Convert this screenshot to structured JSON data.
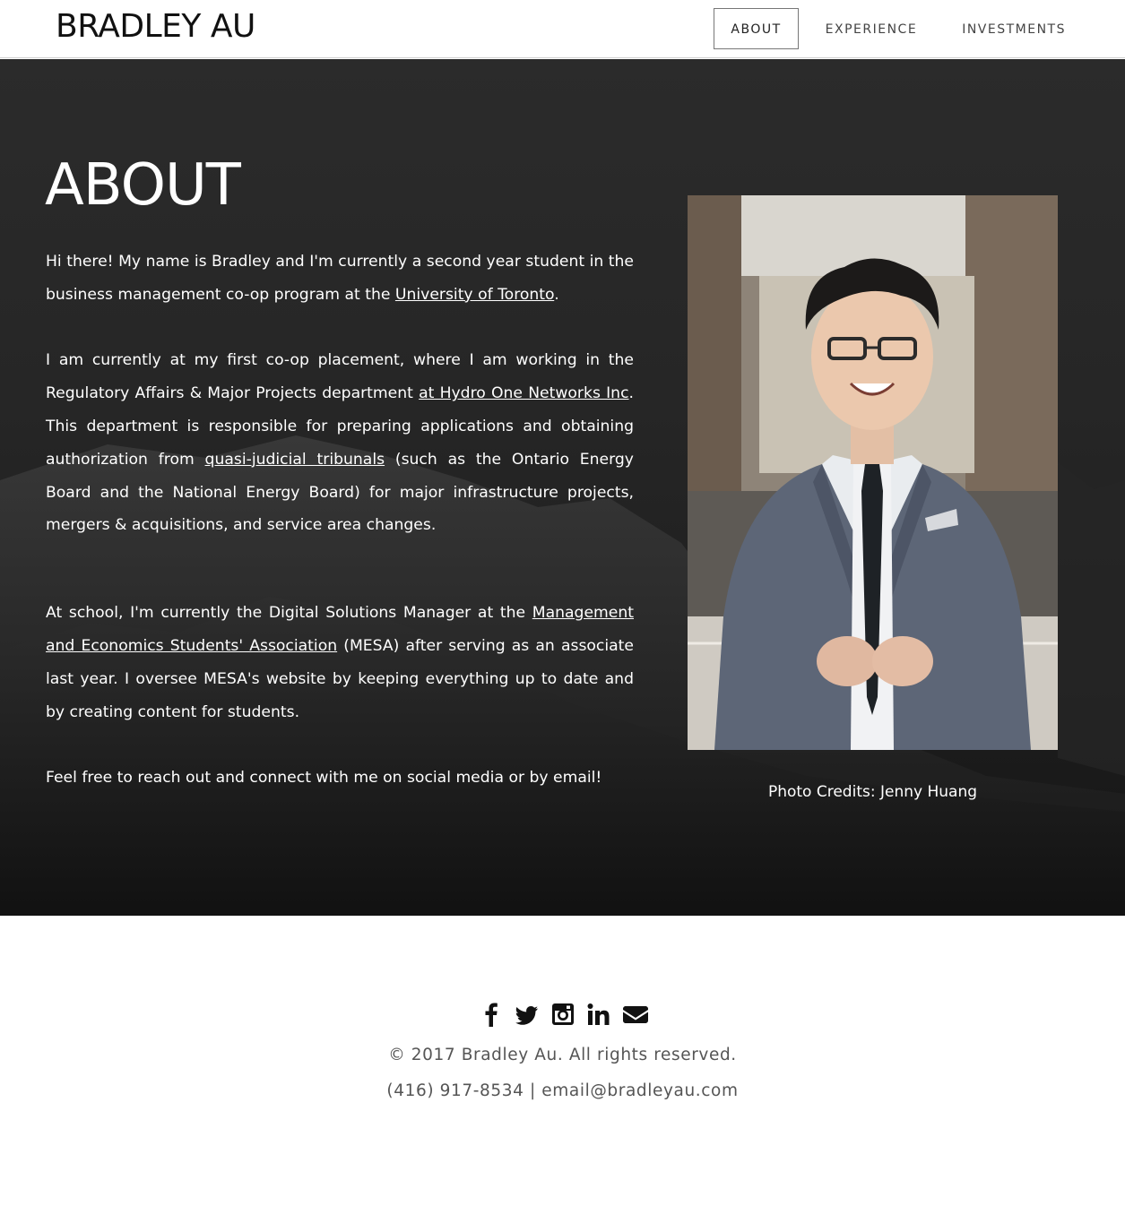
{
  "header": {
    "logo": "BRADLEY AU",
    "nav": [
      {
        "label": "ABOUT",
        "active": true
      },
      {
        "label": "EXPERIENCE",
        "active": false
      },
      {
        "label": "INVESTMENTS",
        "active": false
      }
    ]
  },
  "about": {
    "title": "ABOUT",
    "p1": {
      "text_before": "Hi there! My name is Bradley and I'm currently a second year student in the business management co-op program at the ",
      "link": "University of Toronto",
      "text_after": "."
    },
    "p2": {
      "text_before": "I am currently at my first co-op placement, where I am working in the Regulatory Affairs & Major Projects department ",
      "link1": "at Hydro One Networks Inc",
      "text_middle": ". This department is responsible for preparing applications and obtaining authorization from ",
      "link2": "quasi-judicial tribunals",
      "text_after": " (such as the Ontario Energy Board and the National Energy Board) for major infrastructure projects, mergers & acquisitions, and service area changes."
    },
    "p3": {
      "text_before": "At school, I'm currently the Digital Solutions Manager at the ",
      "link": "Management and Economics Students' Association",
      "text_after": " (MESA) after serving as an associate last year. I oversee MESA's website by keeping everything up to date and by creating content for students."
    },
    "p4": "Feel free to reach out and connect with me on social media or by email!",
    "photo_credit": "Photo Credits: Jenny Huang"
  },
  "footer": {
    "social": [
      {
        "name": "facebook-icon"
      },
      {
        "name": "twitter-icon"
      },
      {
        "name": "instagram-icon"
      },
      {
        "name": "linkedin-icon"
      },
      {
        "name": "email-icon"
      }
    ],
    "copyright": "© 2017 Bradley Au. All rights reserved.",
    "phone": "(416) 917-8534",
    "separator": " | ",
    "email": "email@bradleyau.com"
  },
  "colors": {
    "hero_bg": "#262626",
    "text_light": "#ffffff",
    "footer_text": "#555555",
    "icon": "#111111"
  }
}
